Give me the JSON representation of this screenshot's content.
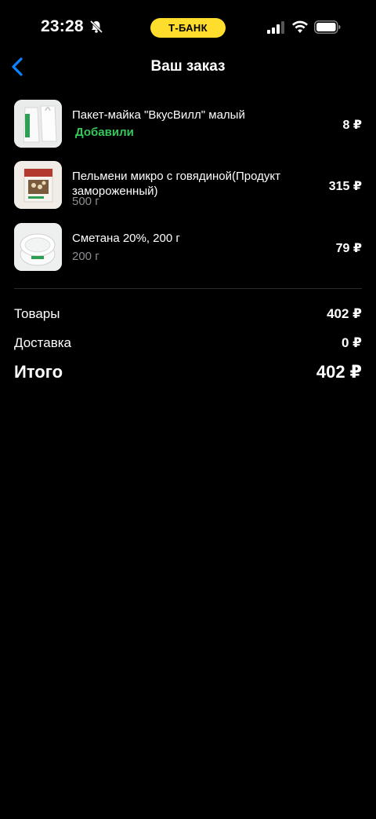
{
  "status_bar": {
    "time": "23:28",
    "carrier_badge": "Т-БАНК",
    "icons": [
      "bell-slash-icon",
      "cellular-signal-icon",
      "wifi-icon",
      "battery-icon"
    ]
  },
  "header": {
    "title": "Ваш заказ",
    "back_icon": "chevron-left-icon"
  },
  "items": [
    {
      "name": "Пакет-майка \"ВкусВилл\" малый",
      "status": "Добавили",
      "price": "8 ₽"
    },
    {
      "name": "Пельмени микро с говядиной(Продукт замороженный)",
      "weight": "500 г",
      "price": "315 ₽"
    },
    {
      "name": "Сметана 20%, 200 г",
      "weight": "200 г",
      "price": "79 ₽"
    }
  ],
  "summary": {
    "goods_label": "Товары",
    "goods_value": "402 ₽",
    "delivery_label": "Доставка",
    "delivery_value": "0 ₽",
    "total_label": "Итого",
    "total_value": "402 ₽"
  },
  "colors": {
    "background": "#000000",
    "accent_blue": "#0a84ff",
    "added_green": "#34c759",
    "bank_yellow": "#ffdd2d"
  }
}
